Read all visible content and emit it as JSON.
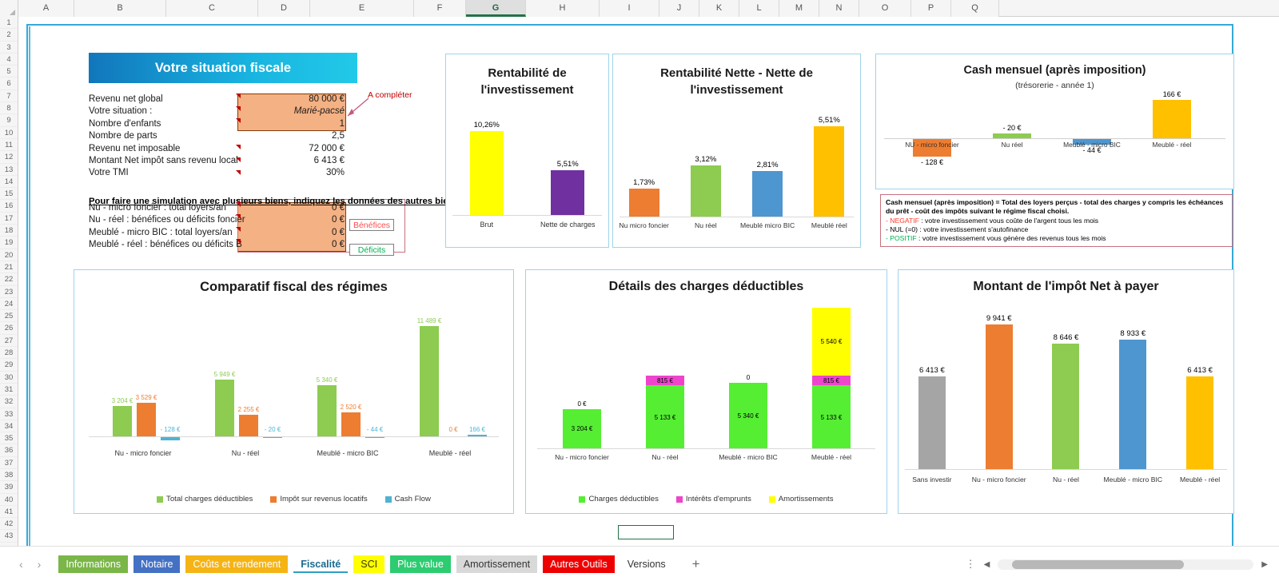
{
  "spreadsheet": {
    "columns": [
      "A",
      "B",
      "C",
      "D",
      "E",
      "F",
      "G",
      "H",
      "I",
      "J",
      "K",
      "L",
      "M",
      "N",
      "O",
      "P",
      "Q"
    ],
    "selected_column": "G",
    "rows": [
      "1",
      "2",
      "3",
      "4",
      "5",
      "6",
      "7",
      "8",
      "9",
      "10",
      "11",
      "12",
      "13",
      "14",
      "15",
      "16",
      "17",
      "18",
      "19",
      "20",
      "21",
      "22",
      "23",
      "24",
      "25",
      "26",
      "27",
      "28",
      "29",
      "30",
      "31",
      "32",
      "33",
      "34",
      "35",
      "36",
      "37",
      "38",
      "39",
      "40",
      "41",
      "42",
      "43"
    ]
  },
  "situation": {
    "title": "Votre situation fiscale",
    "rows": [
      {
        "label": "Revenu net global",
        "value": "80 000 €",
        "italic": false
      },
      {
        "label": "Votre situation :",
        "value": "Marié-pacsé",
        "italic": true
      },
      {
        "label": "Nombre d'enfants",
        "value": "1",
        "italic": false
      },
      {
        "label": "Nombre de parts",
        "value": "2,5",
        "italic": false
      },
      {
        "label": "Revenu net imposable",
        "value": "72 000 €",
        "italic": false
      },
      {
        "label": "Montant Net impôt sans revenu local",
        "value": "6 413 €",
        "italic": false
      },
      {
        "label": "Votre TMI",
        "value": "30%",
        "italic": false
      }
    ],
    "annotation": "A compléter",
    "simulation_note": "Pour faire une simulation avec plusieurs biens, indiquez les données des autres biens :",
    "simulation_rows": [
      {
        "label": "Nu - micro foncier : total loyers/an",
        "value": "0 €",
        "badge": ""
      },
      {
        "label": "Nu - réel : bénéfices ou déficits foncier",
        "value": "0 €",
        "badge": "Bénéfices"
      },
      {
        "label": "Meublé - micro BIC : total loyers/an",
        "value": "0 €",
        "badge": ""
      },
      {
        "label": "Meublé - réel : bénéfices ou déficits B",
        "value": "0 €",
        "badge": "Déficits"
      }
    ],
    "badge_benefices": "Bénéfices",
    "badge_deficits": "Déficits"
  },
  "cash_note": {
    "line1": "Cash mensuel (après imposition) = Total des loyers perçus - total des charges y compris les échéances du prêt - coût des impôts suivant le régime fiscal choisi.",
    "neg_tag": "- NEGATIF",
    "neg_text": " : votre investissement vous coûte de l'argent tous les mois",
    "nul_tag": "- NUL (=0)",
    "nul_text": " : votre investissement s'autofinance",
    "pos_tag": "- POSITIF",
    "pos_text": " : votre investissement vous génère des revenus tous les mois"
  },
  "chart_data": [
    {
      "id": "rentabilite",
      "type": "bar",
      "title": "Rentabilité de l'investissement",
      "categories": [
        "Brut",
        "Nette de charges"
      ],
      "values": [
        10.26,
        5.51
      ],
      "labels": [
        "10,26%",
        "5,51%"
      ],
      "colors": [
        "#ffff00",
        "#7030a0"
      ],
      "ylim": [
        0,
        12
      ],
      "xlabel": "",
      "ylabel": "",
      "grid": false,
      "legend": "none"
    },
    {
      "id": "rentabilite-nette",
      "type": "bar",
      "title": "Rentabilité Nette - Nette de l'investissement",
      "categories": [
        "Nu micro foncier",
        "Nu réel",
        "Meublé micro BIC",
        "Meublé réel"
      ],
      "values": [
        1.73,
        3.12,
        2.81,
        5.51
      ],
      "labels": [
        "1,73%",
        "3,12%",
        "2,81%",
        "5,51%"
      ],
      "colors": [
        "#ed7d31",
        "#8ecb51",
        "#4e96d0",
        "#ffc000"
      ],
      "ylim": [
        0,
        6.2
      ],
      "xlabel": "",
      "ylabel": "",
      "grid": false,
      "legend": "none"
    },
    {
      "id": "cash-mensuel",
      "type": "bar",
      "title": "Cash mensuel (après imposition)",
      "subtitle": "(trésorerie - année 1)",
      "categories": [
        "NU - micro foncier",
        "Nu réel",
        "Meublé - micro BIC",
        "Meublé - réel"
      ],
      "values": [
        -128,
        20,
        -44,
        166
      ],
      "labels": [
        "- 128 €",
        "- 20 €",
        "- 44 €",
        "166 €"
      ],
      "colors": [
        "#ed7d31",
        "#8ecb51",
        "#4e96d0",
        "#ffc000"
      ],
      "ylim": [
        -150,
        180
      ],
      "xlabel": "",
      "ylabel": "",
      "grid": false,
      "legend": "none"
    },
    {
      "id": "comparatif-fiscal",
      "type": "bar",
      "title": "Comparatif fiscal des régimes",
      "categories": [
        "Nu - micro foncier",
        "Nu - réel",
        "Meublé - micro BIC",
        "Meublé - réel"
      ],
      "series": [
        {
          "name": "Total charges déductibles",
          "color": "#8ecb51",
          "values": [
            3204,
            5949,
            5340,
            11489
          ],
          "labels": [
            "3 204 €",
            "5 949 €",
            "5 340 €",
            "11 489 €"
          ]
        },
        {
          "name": "Impôt sur revenus locatifs",
          "color": "#ed7d31",
          "values": [
            3529,
            2255,
            2520,
            0
          ],
          "labels": [
            "3 529 €",
            "2 255 €",
            "2 520 €",
            "0 €"
          ]
        },
        {
          "name": "Cash Flow",
          "color": "#4eb3d3",
          "values": [
            -128,
            -20,
            -44,
            166
          ],
          "labels": [
            "- 128 €",
            "- 20 €",
            "- 44 €",
            "166 €"
          ]
        }
      ],
      "ylim": [
        -300,
        12500
      ],
      "xlabel": "",
      "ylabel": "",
      "grid": false,
      "legend": "bottom"
    },
    {
      "id": "details-charges",
      "type": "bar",
      "stacked": true,
      "title": "Détails des charges déductibles",
      "categories": [
        "Nu - micro foncier",
        "Nu - réel",
        "Meublé - micro BIC",
        "Meublé - réel"
      ],
      "series": [
        {
          "name": "Charges déductibles",
          "color": "#55ee33",
          "values": [
            3204,
            5133,
            5340,
            5133
          ],
          "labels": [
            "3 204 €",
            "5 133 €",
            "5 340 €",
            "5 133 €"
          ]
        },
        {
          "name": "Intérêts d'emprunts",
          "color": "#ee44cc",
          "values": [
            0,
            815,
            0,
            815
          ],
          "labels": [
            "0 €",
            "815 €",
            "0",
            "815 €"
          ]
        },
        {
          "name": "Amortissements",
          "color": "#ffff00",
          "values": [
            0,
            0,
            0,
            5540
          ],
          "labels": [
            "",
            "",
            "",
            "5 540 €"
          ]
        }
      ],
      "ylim": [
        0,
        11600
      ],
      "xlabel": "",
      "ylabel": "",
      "grid": false,
      "legend": "bottom"
    },
    {
      "id": "impot-net",
      "type": "bar",
      "title": "Montant de l'impôt Net à payer",
      "categories": [
        "Sans investir",
        "Nu - micro foncier",
        "Nu - réel",
        "Meublé - micro BIC",
        "Meublé - réel"
      ],
      "values": [
        6413,
        9941,
        8646,
        8933,
        6413
      ],
      "labels": [
        "6 413 €",
        "9 941 €",
        "8 646 €",
        "8 933 €",
        "6 413 €"
      ],
      "colors": [
        "#a5a5a5",
        "#ed7d31",
        "#8ecb51",
        "#4e96d0",
        "#ffc000"
      ],
      "ylim": [
        0,
        10600
      ],
      "xlabel": "",
      "ylabel": "",
      "grid": false,
      "legend": "none"
    }
  ],
  "tabbar": {
    "prev_label": "‹",
    "next_label": "›",
    "add_label": "+",
    "menu_label": "⋮",
    "scroll_left": "◀",
    "scroll_right": "▶",
    "tabs": [
      {
        "label": "Informations",
        "bg": "#7ab648",
        "color": "#ffffff",
        "active": false
      },
      {
        "label": "Notaire",
        "bg": "#4471c4",
        "color": "#ffffff",
        "active": false
      },
      {
        "label": "Coûts et rendement",
        "bg": "#f5b416",
        "color": "#ffffff",
        "active": false
      },
      {
        "label": "Fiscalité",
        "bg": "#ffffff",
        "color": "#1a6b8f",
        "active": true
      },
      {
        "label": "SCI",
        "bg": "#ffff00",
        "color": "#3a3a00",
        "active": false
      },
      {
        "label": "Plus value",
        "bg": "#2ecc71",
        "color": "#ffffff",
        "active": false
      },
      {
        "label": "Amortissement",
        "bg": "#d9d9d9",
        "color": "#333333",
        "active": false
      },
      {
        "label": "Autres Outils",
        "bg": "#ef0000",
        "color": "#ffffff",
        "active": false
      },
      {
        "label": "Versions",
        "bg": "transparent",
        "color": "#333333",
        "active": false
      }
    ]
  }
}
